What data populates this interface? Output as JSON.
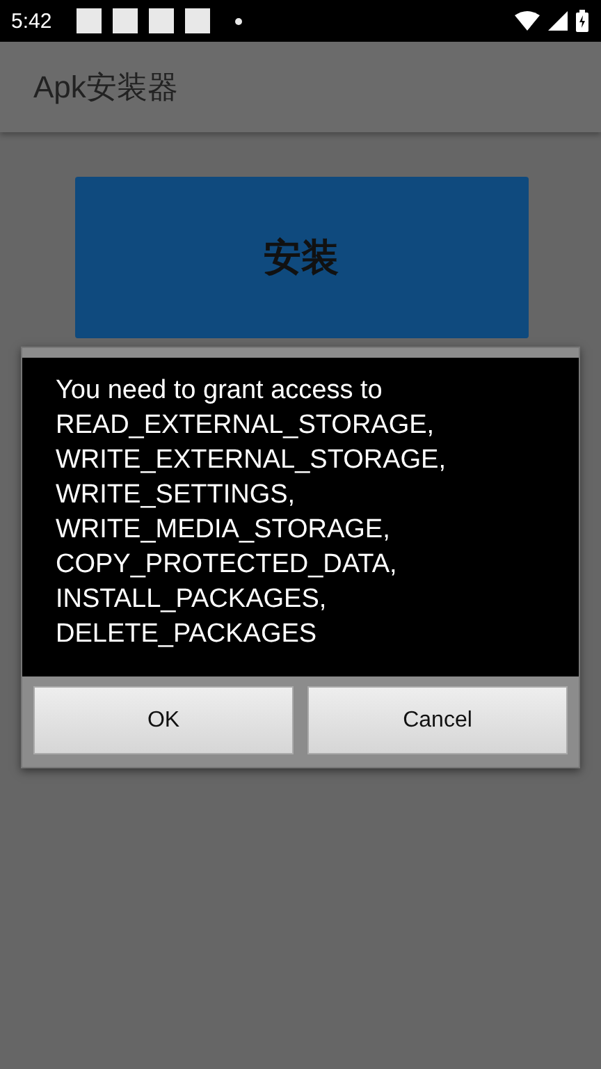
{
  "status_bar": {
    "time": "5:42"
  },
  "app_bar": {
    "title": "Apk安装器"
  },
  "main_buttons": [
    "安装"
  ],
  "dialog": {
    "message_lines": [
      "You need to grant access to",
      "READ_EXTERNAL_STORAGE,",
      "WRITE_EXTERNAL_STORAGE,",
      "WRITE_SETTINGS,",
      "WRITE_MEDIA_STORAGE,",
      "COPY_PROTECTED_DATA,",
      "INSTALL_PACKAGES,",
      "DELETE_PACKAGES"
    ],
    "buttons": [
      "OK",
      "Cancel"
    ]
  }
}
